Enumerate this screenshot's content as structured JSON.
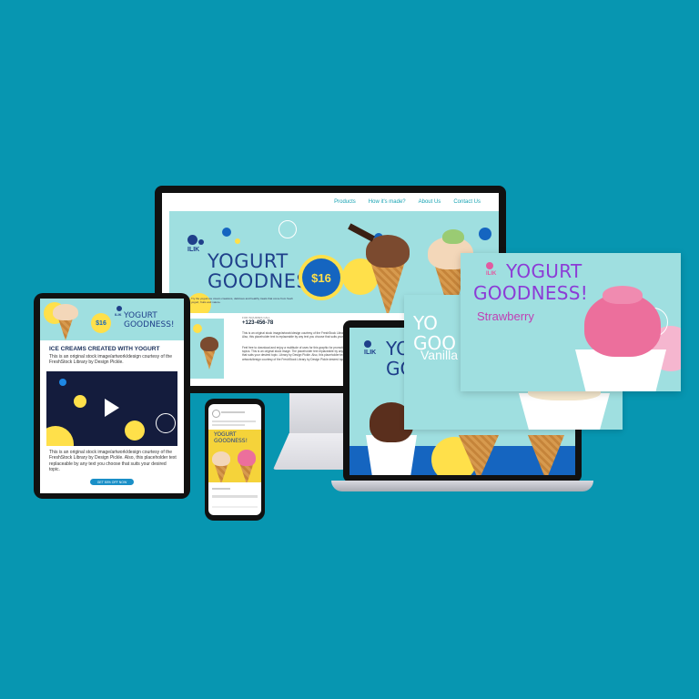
{
  "desktop": {
    "nav": [
      "Products",
      "How it's made?",
      "About Us",
      "Contact Us"
    ],
    "hero_title_line1": "YOGURT",
    "hero_title_line2": "GOODNESS!",
    "hero_sub": "Try the yogurt-ice cream creations, delicious and healthy treats that come from fresh yogurt, fruits and nature.",
    "price": "$16",
    "logo_text": "ILIK",
    "phone_label": "FOR INQUIRIES CALL",
    "phone": "+123-456-78",
    "para1": "This is an original stock image/artwork/design courtesy of the FreshStock Library by Design Pickle. Also, this placeholder text is replaceable by any text you choose that suits your desired topic.",
    "para2": "Feel free to download and enjoy a multitude of uses for this graphic for promotions and be different topics. This is an original stock image. The placeholder text replaceable by any text you choose that suits your desired topic. Library by Design Pickle. Also, this placeholder text replaceable by the artwork/design courtesy of the FreshStock Library by Design Pickle desired topic."
  },
  "tablet": {
    "title_line1": "YOGURT",
    "title_line2": "GOODNESS!",
    "price": "$16",
    "logo_text": "ILIK",
    "heading": "ICE CREAMS CREATED WITH YOGURT",
    "para1": "This is an original stock image/artwork/design courtesy of the FreshStock Library by Design Pickle.",
    "para2": "This is an original stock image/artwork/design courtesy of the FreshStock Library by Design Pickle. Also, this placeholder text replaceable by any text you choose that suits your desired topic.",
    "cta": "GET 50% OFF NOW"
  },
  "phone": {
    "title_line1": "YOGURT",
    "title_line2": "GOODNESS!"
  },
  "laptop": {
    "title_line1": "YO",
    "title_line2": "GOODNE",
    "logo_text": "ILIK"
  },
  "card_mid": {
    "title": "YO",
    "title_line2": "GOO",
    "flavor": "Vanilla"
  },
  "card_front": {
    "logo_text": "ILIK",
    "title_line1": "YOGURT",
    "title_line2": "GOODNESS!",
    "flavor": "Strawberry"
  },
  "colors": {
    "background": "#0796b1",
    "hero_bg": "#9fdfe0",
    "title_blue": "#1f3f8a",
    "accent_yellow": "#ffe04a",
    "accent_blue": "#1565c0",
    "title_purple": "#8c3bd6"
  },
  "icons": {
    "play": "play-icon"
  }
}
